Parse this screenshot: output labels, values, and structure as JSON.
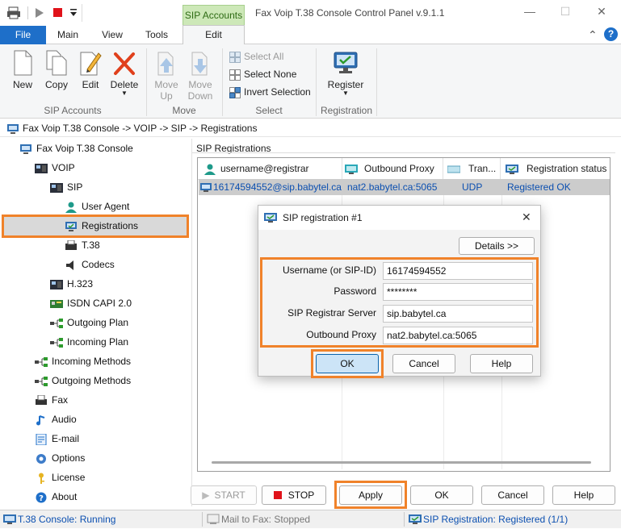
{
  "window": {
    "title": "Fax Voip T.38 Console Control Panel v.9.1.1",
    "context_tab": "SIP Accounts",
    "controls": {
      "minimize": "—",
      "maximize": "☐",
      "close": "✕"
    }
  },
  "ribbon": {
    "tabs": [
      "File",
      "Main",
      "View",
      "Tools",
      "Edit"
    ],
    "help_icons": {
      "collapse": "⌃",
      "help": "?"
    },
    "sip_accounts": {
      "new": "New",
      "copy": "Copy",
      "edit": "Edit",
      "delete": "Delete",
      "group": "SIP Accounts"
    },
    "move": {
      "up": "Move Up",
      "up1": "Move",
      "up2": "Up",
      "down1": "Move",
      "down2": "Down",
      "group": "Move"
    },
    "select": {
      "all": "Select All",
      "none": "Select None",
      "invert": "Invert Selection",
      "group": "Select"
    },
    "registration": {
      "register": "Register",
      "group": "Registration"
    }
  },
  "breadcrumb": "Fax Voip T.38 Console -> VOIP -> SIP -> Registrations",
  "tree": [
    "Fax Voip T.38 Console",
    "VOIP",
    "SIP",
    "User Agent",
    "Registrations",
    "T.38",
    "Codecs",
    "H.323",
    "ISDN CAPI 2.0",
    "Outgoing Plan",
    "Incoming Plan",
    "Incoming Methods",
    "Outgoing Methods",
    "Fax",
    "Audio",
    "E-mail",
    "Options",
    "License",
    "About"
  ],
  "registrations": {
    "panel_title": "SIP Registrations",
    "columns": [
      "username@registrar",
      "Outbound Proxy",
      "Tran...",
      "Registration status"
    ],
    "rows": [
      {
        "user": "16174594552@sip.babytel.ca",
        "proxy": "nat2.babytel.ca:5065",
        "transport": "UDP",
        "status": "Registered OK"
      }
    ]
  },
  "dialog": {
    "title": "SIP registration #1",
    "details_button": "Details >>",
    "fields": {
      "username_label": "Username (or SIP-ID)",
      "username_value": "16174594552",
      "password_label": "Password",
      "password_value": "********",
      "registrar_label": "SIP Registrar Server",
      "registrar_value": "sip.babytel.ca",
      "proxy_label": "Outbound Proxy",
      "proxy_value": "nat2.babytel.ca:5065"
    },
    "ok": "OK",
    "cancel": "Cancel",
    "help": "Help",
    "close": "✕"
  },
  "bottom_buttons": {
    "start": "START",
    "stop": "STOP",
    "apply": "Apply",
    "ok": "OK",
    "cancel": "Cancel",
    "help": "Help"
  },
  "status_bar": {
    "console": "T.38 Console: Running",
    "mail": "Mail to Fax: Stopped",
    "sip": "SIP Registration: Registered (1/1)"
  },
  "colors": {
    "accent": "#1e6fc9",
    "highlight": "#f0822a",
    "context_tab": "#cde8b8",
    "link": "#0b4fb0"
  }
}
